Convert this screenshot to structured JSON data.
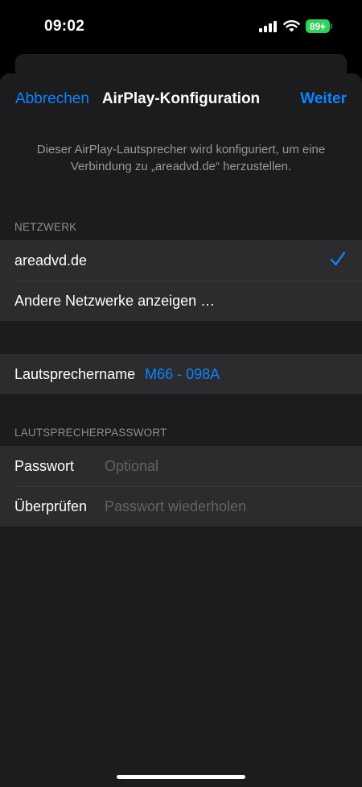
{
  "status_bar": {
    "time": "09:02",
    "battery_level": "89",
    "battery_color": "#30d158",
    "icons": [
      "signal-icon",
      "wifi-icon",
      "battery-charging-icon"
    ]
  },
  "nav": {
    "cancel_label": "Abbrechen",
    "title": "AirPlay-Konfiguration",
    "next_label": "Weiter"
  },
  "description": "Dieser AirPlay-Lautsprecher wird konfiguriert, um eine Verbindung zu „areadvd.de“ herzustellen.",
  "network": {
    "header": "NETZWERK",
    "selected_network": "areadvd.de",
    "other_networks_label": "Andere Netzwerke anzeigen …"
  },
  "speaker": {
    "name_label": "Lautsprechername",
    "name_value": "M66 - 098A"
  },
  "password": {
    "header": "LAUTSPRECHERPASSWORT",
    "password_label": "Passwort",
    "password_placeholder": "Optional",
    "verify_label": "Überprüfen",
    "verify_placeholder": "Passwort wiederholen"
  },
  "colors": {
    "accent": "#0a84ff",
    "sheet_background": "#1c1c1e",
    "cell_background": "#2c2c2e"
  }
}
